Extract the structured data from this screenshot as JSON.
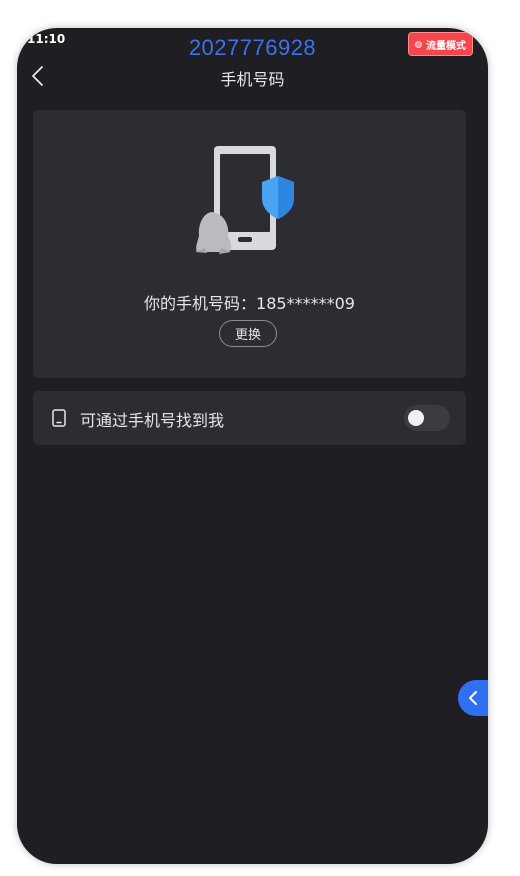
{
  "status_bar": {
    "time": "11:10"
  },
  "header": {
    "account_number": "2027776928",
    "mode_badge": "流量模式",
    "title": "手机号码"
  },
  "card": {
    "phone_number_text": "你的手机号码：185******09",
    "change_button_label": "更换"
  },
  "find_me": {
    "label": "可通过手机号找到我",
    "enabled": false
  },
  "icons": {
    "back": "chevron-left-icon",
    "phone_row": "smartphone-icon",
    "side_tab": "chevron-left-icon",
    "illustration": "phone-shield-penguin-illustration"
  },
  "colors": {
    "background": "#1e1e23",
    "card": "#2c2d32",
    "accent_blue": "#3c72ee",
    "badge_red": "#f4464e"
  }
}
